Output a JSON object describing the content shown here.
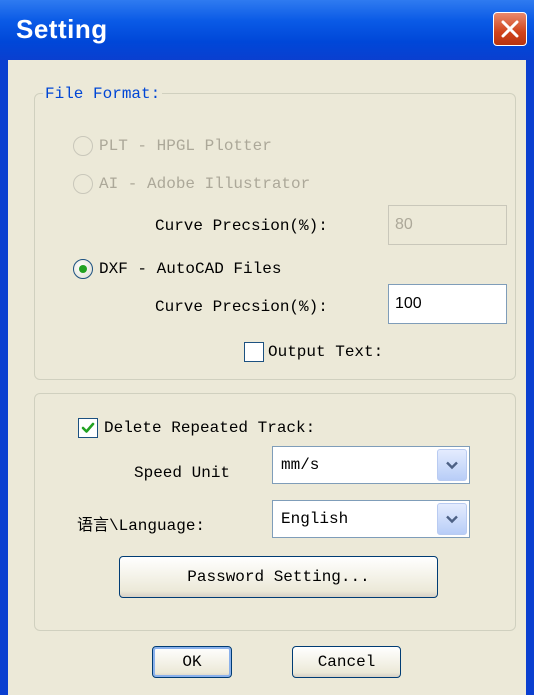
{
  "window": {
    "title": "Setting"
  },
  "file_format": {
    "legend": "File Format:",
    "plt_label": "PLT - HPGL Plotter",
    "ai_label": "AI - Adobe Illustrator",
    "ai_curve_label": "Curve Precsion(%):",
    "ai_curve_value": "80",
    "dxf_label": "DXF - AutoCAD Files",
    "dxf_curve_label": "Curve Precsion(%):",
    "dxf_curve_value": "100",
    "output_text_label": "Output Text:",
    "selected": "DXF"
  },
  "options": {
    "delete_repeated_label": "Delete Repeated Track:",
    "delete_repeated_checked": true,
    "output_text_checked": false,
    "speed_unit_label": "Speed Unit",
    "speed_unit_value": "mm/s",
    "language_label": "语言\\Language:",
    "language_value": "English",
    "password_button": "Password Setting..."
  },
  "buttons": {
    "ok": "OK",
    "cancel": "Cancel"
  },
  "icons": {
    "close": "close-icon",
    "check": "check-icon",
    "dropdown": "chevron-down-icon"
  },
  "colors": {
    "titlebar": "#0a5ae6",
    "close_button": "#d0431b",
    "dialog_bg": "#ece9d8",
    "group_legend": "#0046d5"
  }
}
